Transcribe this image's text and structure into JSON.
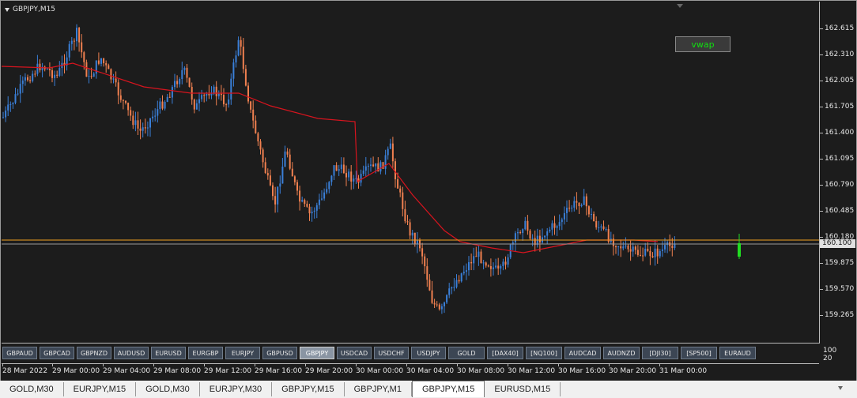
{
  "chart": {
    "symbol_title": "GBPJPY,M15",
    "indicator_button": "vwap",
    "current_price": "160.100",
    "colors": {
      "bull": "#3a7fd8",
      "bear": "#f08050",
      "vwap": "#d8141e",
      "hline": "#f0a020",
      "bid": "#9a9a9a",
      "volume_bar": "#22dd22"
    }
  },
  "price_axis": [
    "162.615",
    "162.310",
    "162.005",
    "161.705",
    "161.400",
    "161.095",
    "160.790",
    "160.485",
    "160.180",
    "159.875",
    "159.570",
    "159.265"
  ],
  "symbols": [
    "GBPAUD",
    "GBPCAD",
    "GBPNZD",
    "AUDUSD",
    "EURUSD",
    "EURGBP",
    "EURJPY",
    "GBPUSD",
    "GBPJPY",
    "USDCAD",
    "USDCHF",
    "USDJPY",
    "GOLD",
    "[DAX40]",
    "[NQ100]",
    "AUDCAD",
    "AUDNZD",
    "[DJI30]",
    "[SP500]",
    "EURAUD"
  ],
  "active_symbol": "GBPJPY",
  "sub_axis": [
    "100",
    "20"
  ],
  "time_axis": [
    "28 Mar 2022",
    "29 Mar 00:00",
    "29 Mar 04:00",
    "29 Mar 08:00",
    "29 Mar 12:00",
    "29 Mar 16:00",
    "29 Mar 20:00",
    "30 Mar 00:00",
    "30 Mar 04:00",
    "30 Mar 08:00",
    "30 Mar 12:00",
    "30 Mar 16:00",
    "30 Mar 20:00",
    "31 Mar 00:00"
  ],
  "tabs": [
    "GOLD,M30",
    "EURJPY,M15",
    "GOLD,M30",
    "EURJPY,M30",
    "GBPJPY,M15",
    "GBPJPY,M1",
    "GBPJPY,M15",
    "EURUSD,M15"
  ],
  "active_tab_index": 6
}
